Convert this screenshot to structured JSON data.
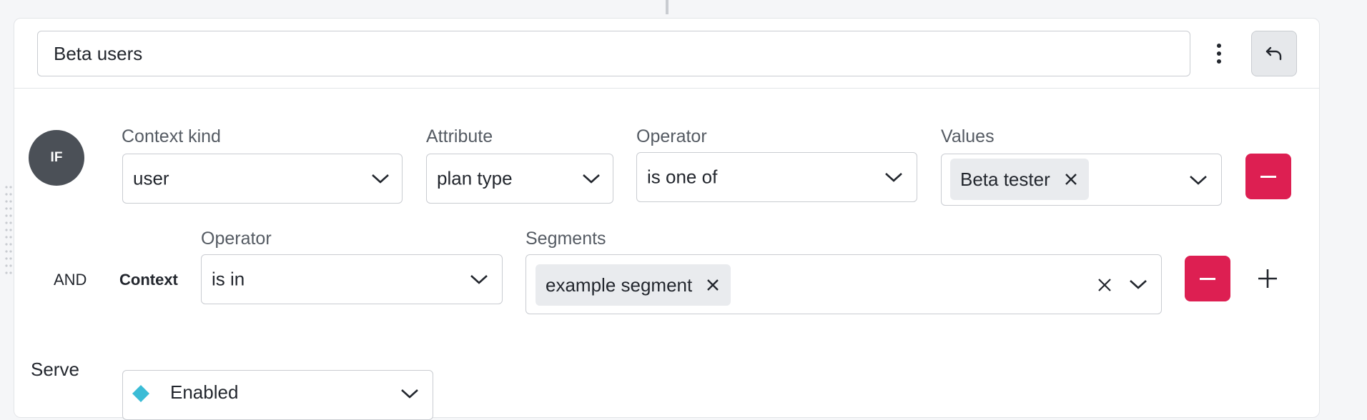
{
  "rule": {
    "name": "Beta users",
    "if_label": "IF",
    "and_label": "AND",
    "context_label": "Context"
  },
  "clause1": {
    "context_kind_label": "Context kind",
    "context_kind_value": "user",
    "attribute_label": "Attribute",
    "attribute_value": "plan type",
    "operator_label": "Operator",
    "operator_value": "is one of",
    "values_label": "Values",
    "values": [
      "Beta tester"
    ]
  },
  "clause2": {
    "operator_label": "Operator",
    "operator_value": "is in",
    "segments_label": "Segments",
    "segments": [
      "example segment"
    ]
  },
  "serve": {
    "label": "Serve",
    "value": "Enabled",
    "variation_color": "#3bbcd6"
  },
  "colors": {
    "danger": "#dd1f52",
    "badge": "#4b5057"
  },
  "icons": {
    "more": "kebab-vertical",
    "revert": "undo-arrow",
    "chevron": "chevron-down",
    "remove": "minus",
    "add": "plus",
    "clear": "x"
  }
}
